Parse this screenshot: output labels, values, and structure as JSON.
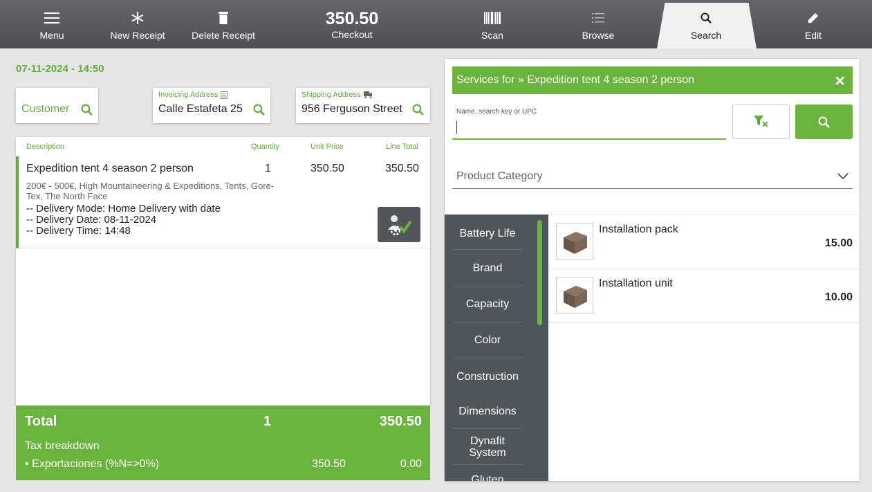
{
  "toolbar": {
    "menu": "Menu",
    "new_receipt": "New Receipt",
    "delete_receipt": "Delete Receipt",
    "checkout_amount": "350.50",
    "checkout": "Checkout",
    "scan": "Scan",
    "browse": "Browse",
    "search": "Search",
    "edit": "Edit"
  },
  "receipt": {
    "datetime": "07-11-2024 - 14:50",
    "customer_label": "Customer",
    "invoicing_caption": "Invoicing Address",
    "invoicing_value": "Calle Estafeta 25",
    "shipping_caption": "Shipping Address",
    "shipping_value": "956 Ferguson Street",
    "columns": {
      "description": "Description",
      "quantity": "Quantity",
      "unit_price": "Unit Price",
      "line_total": "Line Total"
    },
    "line": {
      "description": "Expedition tent 4 season 2 person",
      "quantity": "1",
      "unit_price": "350.50",
      "line_total": "350.50",
      "attributes": "200€ - 500€, High Mountaineering & Expeditions, Tents, Gore-Tex, The North Face",
      "delivery_mode": "-- Delivery Mode: Home Delivery with date",
      "delivery_date": "-- Delivery Date: 08-11-2024",
      "delivery_time": "-- Delivery Time: 14:48"
    },
    "total": {
      "label": "Total",
      "quantity": "1",
      "amount": "350.50",
      "tax_title": "Tax breakdown",
      "tax_name": "• Exportaciones (%N=>0%)",
      "tax_base": "350.50",
      "tax_amount": "0.00"
    }
  },
  "services": {
    "title": "Services for » Expedition tent 4 season 2 person",
    "close": "✕",
    "search_placeholder": "Name, search key or UPC",
    "category_label": "Product Category",
    "categories": [
      "Battery Life",
      "Brand",
      "Capacity",
      "Color",
      "Construction",
      "Dimensions",
      "Dynafit System",
      "Gluten"
    ],
    "products": [
      {
        "name": "Installation pack",
        "price": "15.00"
      },
      {
        "name": "Installation unit",
        "price": "10.00"
      }
    ]
  },
  "colors": {
    "accent": "#6ab43e",
    "toolbar": "#55595d",
    "category_panel": "#4e555b"
  }
}
